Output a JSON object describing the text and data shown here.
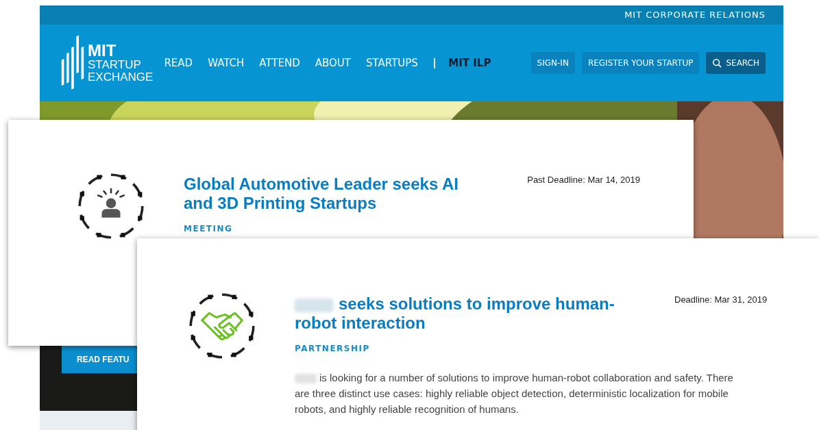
{
  "site": {
    "top_bar_link": "MIT CORPORATE RELATIONS",
    "logo": {
      "line_1": "MIT",
      "line_2": "STARTUP",
      "line_3": "EXCHANGE"
    },
    "nav": [
      {
        "label": "READ",
        "selected": false
      },
      {
        "label": "WATCH",
        "selected": false
      },
      {
        "label": "ATTEND",
        "selected": false
      },
      {
        "label": "ABOUT",
        "selected": false
      },
      {
        "label": "STARTUPS",
        "selected": false
      },
      {
        "label": "MIT ILP",
        "selected": true
      }
    ],
    "nav_separator": "|",
    "buttons": [
      {
        "label": "SIGN-IN",
        "kind": "plain"
      },
      {
        "label": "REGISTER YOUR STARTUP",
        "kind": "plain"
      },
      {
        "label": "SEARCH",
        "kind": "search"
      }
    ],
    "hero_button": "READ FEATU"
  },
  "cards": [
    {
      "kind": "person",
      "title": "Global Automotive Leader seeks AI and 3D Printing Startups",
      "redacted_name": false,
      "deadline": "Past Deadline: Mar 14, 2019",
      "category": "MEETING"
    },
    {
      "kind": "handshake",
      "title": "seeks solutions to improve human-robot interaction",
      "redacted_name": true,
      "deadline": "Deadline: Mar 31, 2019",
      "category": "PARTNERSHIP",
      "description": "is looking for a number of solutions to improve human-robot collaboration and safety. There are three distinct use cases: highly reliable object detection, deterministic localization for mobile robots, and highly reliable recognition of humans."
    }
  ]
}
